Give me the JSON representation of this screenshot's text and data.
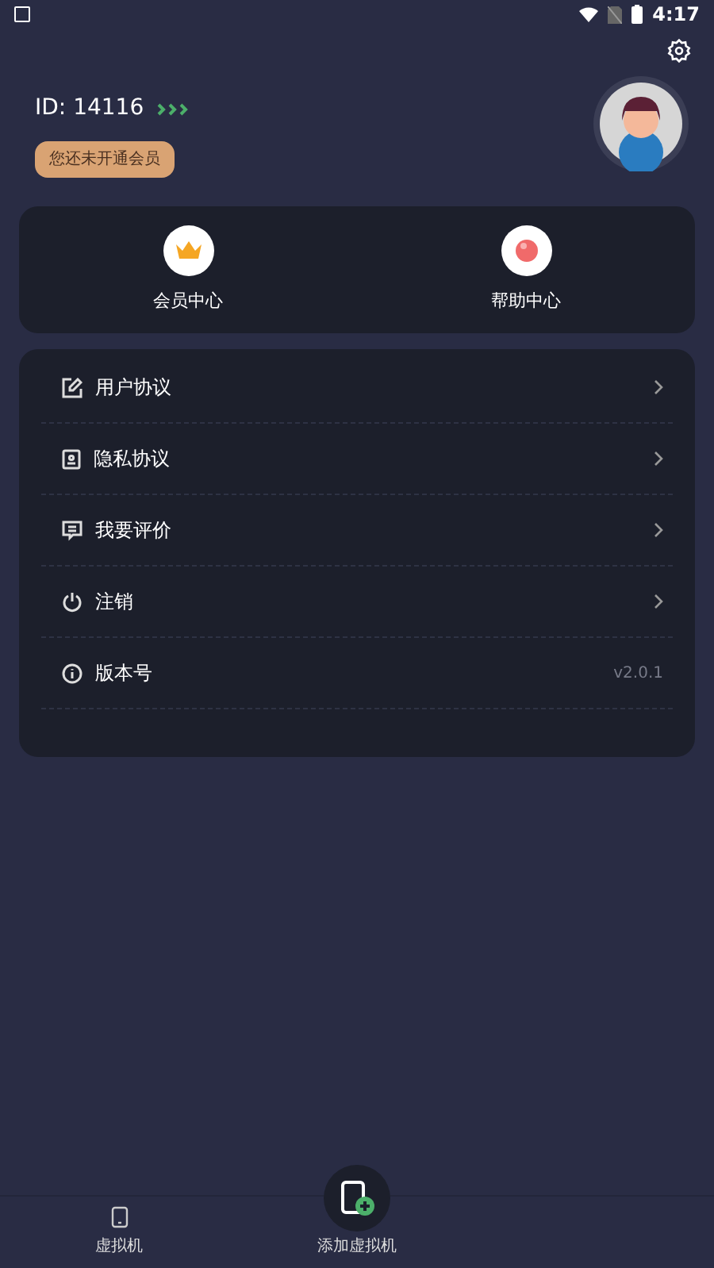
{
  "status_bar": {
    "time": "4:17"
  },
  "profile": {
    "id_label": "ID: 14116",
    "member_badge": "您还未开通会员"
  },
  "shortcuts": [
    {
      "label": "会员中心",
      "kind": "crown"
    },
    {
      "label": "帮助中心",
      "kind": "bulb"
    }
  ],
  "menu": [
    {
      "label": "用户协议",
      "kind": "edit",
      "chevron": true
    },
    {
      "label": "隐私协议",
      "kind": "contact",
      "chevron": true
    },
    {
      "label": "我要评价",
      "kind": "comment",
      "chevron": true
    },
    {
      "label": "注销",
      "kind": "power",
      "chevron": true
    },
    {
      "label": "版本号",
      "kind": "info",
      "chevron": false,
      "value": "v2.0.1"
    }
  ],
  "bottom_nav": [
    {
      "label": "虚拟机",
      "kind": "phone"
    },
    {
      "label": "添加虚拟机",
      "kind": "add"
    }
  ]
}
